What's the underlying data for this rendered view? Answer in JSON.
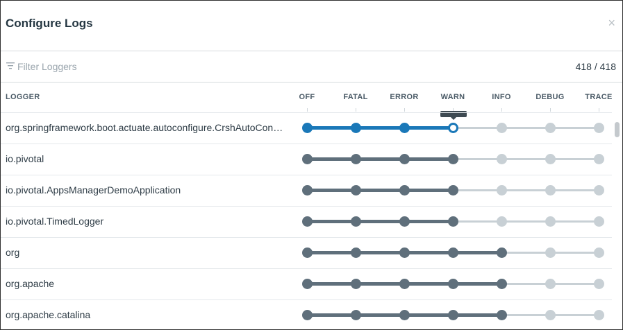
{
  "modal": {
    "title": "Configure Logs",
    "close_icon": "close-icon",
    "close_glyph": "×"
  },
  "filter": {
    "placeholder": "Filter Loggers",
    "icon": "filter-icon",
    "count": "418 / 418"
  },
  "columns": {
    "logger": "LOGGER",
    "levels": [
      "OFF",
      "FATAL",
      "ERROR",
      "WARN",
      "INFO",
      "DEBUG",
      "TRACE"
    ]
  },
  "colors": {
    "active_selected": "#1a78b8",
    "active_default": "#5f6f7b",
    "inactive": "#c8d0d5"
  },
  "loggers": [
    {
      "name": "org.springframework.boot.actuate.autoconfigure.CrshAutoConfiguration",
      "level": "WARN",
      "highlighted": true
    },
    {
      "name": "io.pivotal",
      "level": "WARN",
      "highlighted": false
    },
    {
      "name": "io.pivotal.AppsManagerDemoApplication",
      "level": "WARN",
      "highlighted": false
    },
    {
      "name": "io.pivotal.TimedLogger",
      "level": "WARN",
      "highlighted": false
    },
    {
      "name": "org",
      "level": "INFO",
      "highlighted": false
    },
    {
      "name": "org.apache",
      "level": "INFO",
      "highlighted": false
    },
    {
      "name": "org.apache.catalina",
      "level": "INFO",
      "highlighted": false
    }
  ]
}
